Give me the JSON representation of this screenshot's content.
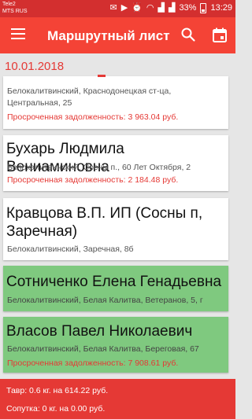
{
  "status_bar": {
    "carrier1": "Tele2",
    "carrier2": "MTS RUS",
    "battery": "33%",
    "time": "13:29"
  },
  "app_bar": {
    "title": "Маршрутный лист",
    "menu_icon": "hamburger-menu-icon",
    "search_icon": "search-icon",
    "calendar_icon": "calendar-icon",
    "color": "#f44336"
  },
  "date": "10.01.2018",
  "cards": [
    {
      "name": "",
      "address_lines": [
        "Белокалитвинский, Краснодонецкая ст-ца,",
        "Центральная, 25"
      ],
      "debt": "Просроченная задолженность: 3 963.04 руб.",
      "highlighted": false
    },
    {
      "name": "Бухарь Людмила Вениаминовна",
      "address_lines": [
        "Белокалитвинский, Сосны п., 60 Лет Октября, 2"
      ],
      "debt": "Просроченная задолженность: 2 184.48 руб.",
      "highlighted": false
    },
    {
      "name_lines": [
        "Кравцова В.П. ИП (Сосны п,",
        "Заречная)"
      ],
      "address_lines": [
        "Белокалитвинский, Заречная, 8б"
      ],
      "debt": "",
      "highlighted": false
    },
    {
      "name": "Сотниченко Елена Генадьевна",
      "address_lines": [
        "Белокалитвинский, Белая Калитва, Ветеранов, 5, г"
      ],
      "debt": "",
      "highlighted": true
    },
    {
      "name": "Власов Павел Николаевич",
      "address_lines": [
        "Белокалитвинский, Белая Калитва, Береговая, 67"
      ],
      "debt": "Просроченная задолженность: 7 908.61 руб.",
      "highlighted": true
    }
  ],
  "footer": {
    "line1": "Тавр: 0.6 кг. на 614.22 руб.",
    "line2": "Сопутка: 0 кг. на 0.00 руб."
  },
  "colors": {
    "status_bar": "#d32f2f",
    "accent": "#e53935",
    "highlight": "#7fc97f"
  }
}
